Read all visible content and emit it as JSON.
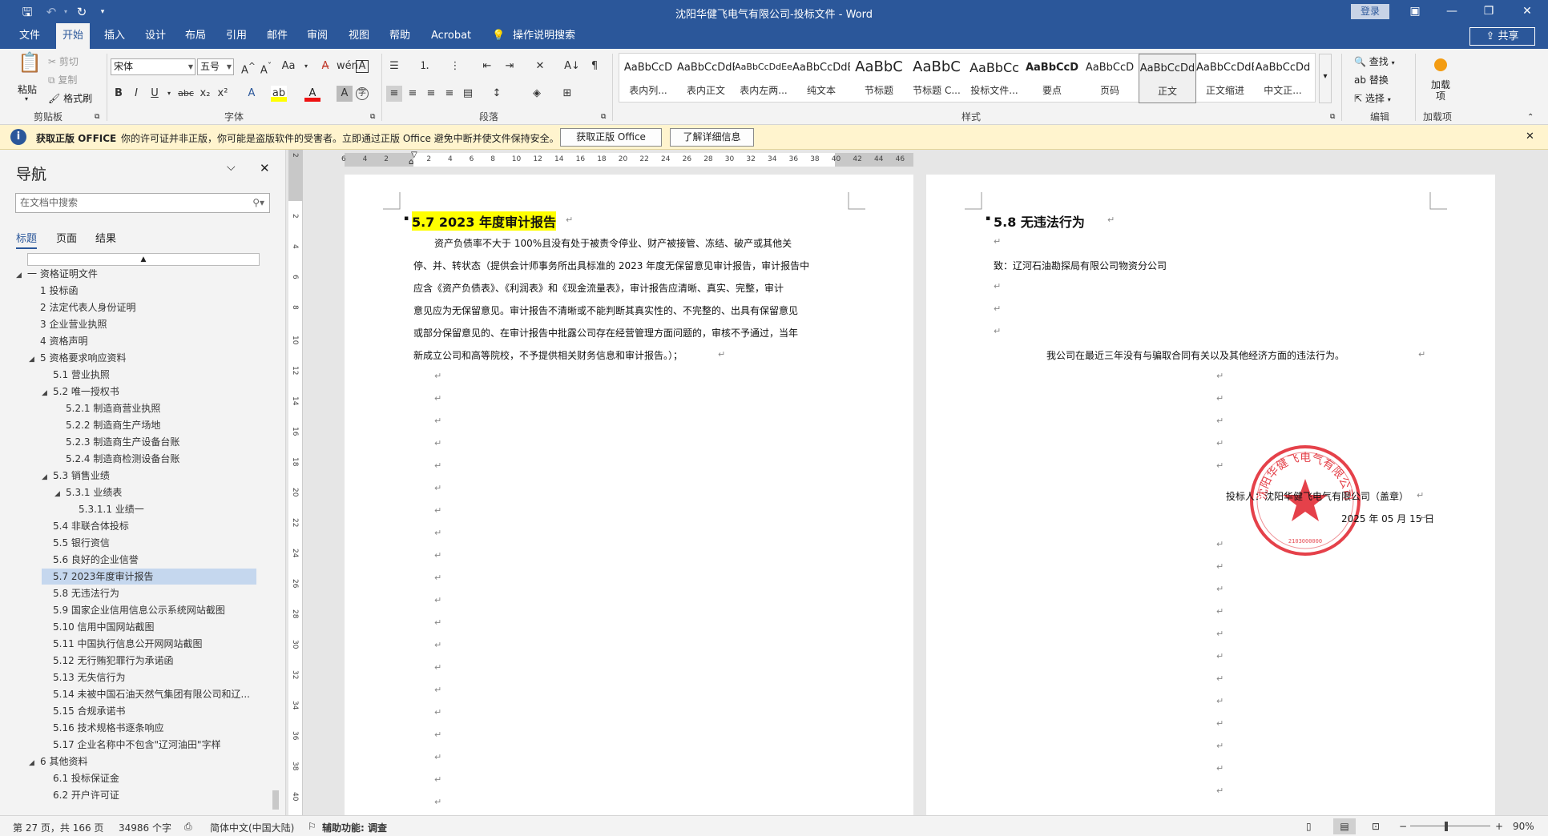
{
  "window": {
    "title": "沈阳华健飞电气有限公司-投标文件  -  Word",
    "login": "登录",
    "share": "共享"
  },
  "tabs": [
    "文件",
    "开始",
    "插入",
    "设计",
    "布局",
    "引用",
    "邮件",
    "审阅",
    "视图",
    "帮助",
    "Acrobat",
    "操作说明搜索"
  ],
  "ribbon": {
    "clipboard": {
      "paste": "粘贴",
      "cut": "剪切",
      "copy": "复制",
      "painter": "格式刷",
      "label": "剪贴板"
    },
    "font": {
      "name": "宋体",
      "size": "五号",
      "label": "字体"
    },
    "paragraph": {
      "label": "段落"
    },
    "styles": {
      "label": "样式",
      "items": [
        {
          "preview": "AaBbCcD",
          "name": "表内列..."
        },
        {
          "preview": "AaBbCcDdE",
          "name": "表内正文"
        },
        {
          "preview": "AaBbCcDdEe",
          "name": "表内左两..."
        },
        {
          "preview": "AaBbCcDdE",
          "name": "纯文本"
        },
        {
          "preview": "AaBbC",
          "name": "节标题"
        },
        {
          "preview": "AaBbC",
          "name": "节标题 C..."
        },
        {
          "preview": "AaBbCc",
          "name": "投标文件..."
        },
        {
          "preview": "AaBbCcD",
          "name": "要点"
        },
        {
          "preview": "AaBbCcD",
          "name": "页码"
        },
        {
          "preview": "AaBbCcDd",
          "name": "正文"
        },
        {
          "preview": "AaBbCcDdE",
          "name": "正文缩进"
        },
        {
          "preview": "AaBbCcDd",
          "name": "中文正..."
        }
      ]
    },
    "editing": {
      "find": "查找",
      "replace": "替换",
      "select": "选择",
      "label": "编辑"
    },
    "addins": {
      "btn": "加载项",
      "label": "加载项"
    }
  },
  "notification": {
    "title": "获取正版 OFFICE",
    "message": "你的许可证并非正版，你可能是盗版软件的受害者。立即通过正版 Office 避免中断并使文件保持安全。",
    "btn1": "获取正版 Office",
    "btn2": "了解详细信息"
  },
  "nav": {
    "title": "导航",
    "search_placeholder": "在文档中搜索",
    "tabs": [
      "标题",
      "页面",
      "结果"
    ],
    "items": [
      {
        "text": "一 资格证明文件",
        "level": 0,
        "arrow": "◢"
      },
      {
        "text": "1 投标函",
        "level": 1,
        "arrow": ""
      },
      {
        "text": "2 法定代表人身份证明",
        "level": 1,
        "arrow": ""
      },
      {
        "text": "3 企业营业执照",
        "level": 1,
        "arrow": ""
      },
      {
        "text": "4 资格声明",
        "level": 1,
        "arrow": ""
      },
      {
        "text": "5 资格要求响应资料",
        "level": 1,
        "arrow": "◢"
      },
      {
        "text": "5.1 营业执照",
        "level": 2,
        "arrow": ""
      },
      {
        "text": "5.2 唯一授权书",
        "level": 2,
        "arrow": "◢"
      },
      {
        "text": "5.2.1 制造商营业执照",
        "level": 3,
        "arrow": ""
      },
      {
        "text": "5.2.2 制造商生产场地",
        "level": 3,
        "arrow": ""
      },
      {
        "text": "5.2.3 制造商生产设备台账",
        "level": 3,
        "arrow": ""
      },
      {
        "text": "5.2.4 制造商检测设备台账",
        "level": 3,
        "arrow": ""
      },
      {
        "text": "5.3 销售业绩",
        "level": 2,
        "arrow": "◢"
      },
      {
        "text": "5.3.1 业绩表",
        "level": 3,
        "arrow": "◢"
      },
      {
        "text": "5.3.1.1 业绩一",
        "level": 4,
        "arrow": ""
      },
      {
        "text": "5.4 非联合体投标",
        "level": 2,
        "arrow": ""
      },
      {
        "text": "5.5 银行资信",
        "level": 2,
        "arrow": ""
      },
      {
        "text": "5.6 良好的企业信誉",
        "level": 2,
        "arrow": ""
      },
      {
        "text": "5.7 2023年度审计报告",
        "level": 2,
        "arrow": "",
        "selected": true
      },
      {
        "text": "5.8 无违法行为",
        "level": 2,
        "arrow": ""
      },
      {
        "text": "5.9 国家企业信用信息公示系统网站截图",
        "level": 2,
        "arrow": ""
      },
      {
        "text": "5.10 信用中国网站截图",
        "level": 2,
        "arrow": ""
      },
      {
        "text": "5.11 中国执行信息公开网网站截图",
        "level": 2,
        "arrow": ""
      },
      {
        "text": "5.12 无行贿犯罪行为承诺函",
        "level": 2,
        "arrow": ""
      },
      {
        "text": "5.13 无失信行为",
        "level": 2,
        "arrow": ""
      },
      {
        "text": "5.14 未被中国石油天然气集团有限公司和辽...",
        "level": 2,
        "arrow": ""
      },
      {
        "text": "5.15 合规承诺书",
        "level": 2,
        "arrow": ""
      },
      {
        "text": "5.16 技术规格书逐条响应",
        "level": 2,
        "arrow": ""
      },
      {
        "text": "5.17 企业名称中不包含\"辽河油田\"字样",
        "level": 2,
        "arrow": ""
      },
      {
        "text": "6 其他资料",
        "level": 1,
        "arrow": "◢"
      },
      {
        "text": "6.1 投标保证金",
        "level": 2,
        "arrow": ""
      },
      {
        "text": "6.2 开户许可证",
        "level": 2,
        "arrow": ""
      }
    ]
  },
  "ruler": {
    "h": [
      "6",
      "4",
      "2",
      "",
      "2",
      "4",
      "6",
      "8",
      "10",
      "12",
      "14",
      "16",
      "18",
      "20",
      "22",
      "24",
      "26",
      "28",
      "30",
      "32",
      "34",
      "36",
      "38",
      "40",
      "42",
      "44",
      "46"
    ],
    "v": [
      "2",
      "",
      "2",
      "4",
      "6",
      "8",
      "10",
      "12",
      "14",
      "16",
      "18",
      "20",
      "22",
      "24",
      "26",
      "28",
      "30",
      "32",
      "34",
      "36",
      "38",
      "40"
    ]
  },
  "page1": {
    "heading": "5.7    2023 年度审计报告",
    "lines": [
      "资产负债率不大于 100%且没有处于被责令停业、财产被接管、冻结、破产或其他关",
      "停、并、转状态（提供会计师事务所出具标准的 2023 年度无保留意见审计报告，审计报告中",
      "应含《资产负债表》、《利润表》和《现金流量表》，审计报告应清晰、真实、完整，审计",
      "意见应为无保留意见。审计报告不清晰或不能判断其真实性的、不完整的、出具有保留意见",
      "或部分保留意见的、在审计报告中批露公司存在经营管理方面问题的，审核不予通过，当年",
      "新成立公司和高等院校，不予提供相关财务信息和审计报告。）；"
    ]
  },
  "page2": {
    "heading": "5.8    无违法行为",
    "to": "致：辽河石油勘探局有限公司物资分公司",
    "statement": "我公司在最近三年没有与骗取合同有关以及其他经济方面的违法行为。",
    "bidder": "投标人：沈阳华健飞电气有限公司（盖章）",
    "date": "2025 年 05 月 15 日",
    "seal_text": "沈阳华健飞电气有限公司"
  },
  "status": {
    "page": "第 27 页，共 166 页",
    "words": "34986 个字",
    "lang": "简体中文(中国大陆)",
    "access": "辅助功能: 调查",
    "zoom": "90%"
  },
  "colors": {
    "accent": "#2b579a",
    "highlight": "#ffff00",
    "seal": "#e0202a"
  }
}
